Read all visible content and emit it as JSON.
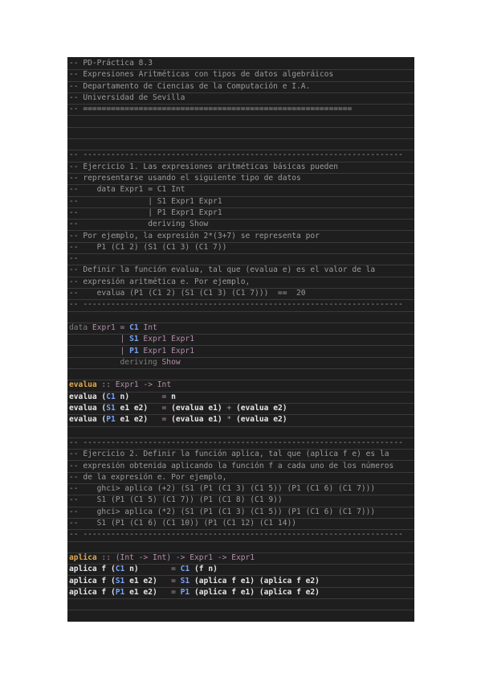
{
  "colors": {
    "background": "#ffffff",
    "editor_bg": "#1e1e1e",
    "comment": "#9b9b9b",
    "keyword": "#a78bc4",
    "type": "#b48ead",
    "constructor": "#7aa2f7",
    "function_name": "#e0a84c",
    "plain": "#e6e6e6"
  },
  "lines": [
    [
      {
        "t": "-- PD-Práctica 8.3",
        "c": "comment"
      }
    ],
    [
      {
        "t": "-- Expresiones Aritméticas con tipos de datos algebráicos",
        "c": "comment"
      }
    ],
    [
      {
        "t": "-- Departamento de Ciencias de la Computación e I.A.",
        "c": "comment"
      }
    ],
    [
      {
        "t": "-- Universidad de Sevilla",
        "c": "comment"
      }
    ],
    [
      {
        "t": "-- ==========================================================",
        "c": "comment"
      }
    ],
    [],
    [],
    [],
    [
      {
        "t": "-- ---------------------------------------------------------------------",
        "c": "comment"
      }
    ],
    [
      {
        "t": "-- Ejercicio 1. Las expresiones aritméticas básicas pueden",
        "c": "comment"
      }
    ],
    [
      {
        "t": "-- representarse usando el siguiente tipo de datos",
        "c": "comment"
      }
    ],
    [
      {
        "t": "--    data Expr1 = C1 Int",
        "c": "comment"
      }
    ],
    [
      {
        "t": "--               | S1 Expr1 Expr1",
        "c": "comment"
      }
    ],
    [
      {
        "t": "--               | P1 Expr1 Expr1",
        "c": "comment"
      }
    ],
    [
      {
        "t": "--               deriving Show",
        "c": "comment"
      }
    ],
    [
      {
        "t": "-- Por ejemplo, la expresión 2*(3+7) se representa por",
        "c": "comment"
      }
    ],
    [
      {
        "t": "--    P1 (C1 2) (S1 (C1 3) (C1 7))",
        "c": "comment"
      }
    ],
    [
      {
        "t": "--",
        "c": "comment"
      }
    ],
    [
      {
        "t": "-- Definir la función evalua, tal que (evalua e) es el valor de la",
        "c": "comment"
      }
    ],
    [
      {
        "t": "-- expresión aritmética e. Por ejemplo,",
        "c": "comment"
      }
    ],
    [
      {
        "t": "--    evalua (P1 (C1 2) (S1 (C1 3) (C1 7)))  ==  20",
        "c": "comment"
      }
    ],
    [
      {
        "t": "-- ---------------------------------------------------------------------",
        "c": "comment"
      }
    ],
    [],
    [
      {
        "t": "data ",
        "c": "faint"
      },
      {
        "t": "Expr1",
        "c": "type"
      },
      {
        "t": " = ",
        "c": "op"
      },
      {
        "t": "C1",
        "c": "ctor"
      },
      {
        "t": " Int",
        "c": "type"
      }
    ],
    [
      {
        "t": "           | ",
        "c": "op"
      },
      {
        "t": "S1",
        "c": "ctor"
      },
      {
        "t": " Expr1 Expr1",
        "c": "type"
      }
    ],
    [
      {
        "t": "           | ",
        "c": "op"
      },
      {
        "t": "P1",
        "c": "ctor"
      },
      {
        "t": " Expr1 Expr1",
        "c": "type"
      }
    ],
    [
      {
        "t": "           deriving ",
        "c": "faint"
      },
      {
        "t": "Show",
        "c": "type"
      }
    ],
    [],
    [
      {
        "t": "evalua",
        "c": "fname"
      },
      {
        "t": " :: ",
        "c": "op"
      },
      {
        "t": "Expr1",
        "c": "type"
      },
      {
        "t": " -> ",
        "c": "op"
      },
      {
        "t": "Int",
        "c": "type"
      }
    ],
    [
      {
        "t": "evalua (",
        "c": "plain"
      },
      {
        "t": "C1",
        "c": "ctor"
      },
      {
        "t": " n)       ",
        "c": "plain"
      },
      {
        "t": "= ",
        "c": "op"
      },
      {
        "t": "n",
        "c": "plain"
      }
    ],
    [
      {
        "t": "evalua (",
        "c": "plain"
      },
      {
        "t": "S1",
        "c": "ctor"
      },
      {
        "t": " e1 e2)   ",
        "c": "plain"
      },
      {
        "t": "= ",
        "c": "op"
      },
      {
        "t": "(evalua e1) ",
        "c": "plain"
      },
      {
        "t": "+ ",
        "c": "op"
      },
      {
        "t": "(evalua e2)",
        "c": "plain"
      }
    ],
    [
      {
        "t": "evalua (",
        "c": "plain"
      },
      {
        "t": "P1",
        "c": "ctor"
      },
      {
        "t": " e1 e2)   ",
        "c": "plain"
      },
      {
        "t": "= ",
        "c": "op"
      },
      {
        "t": "(evalua e1) ",
        "c": "plain"
      },
      {
        "t": "* ",
        "c": "op"
      },
      {
        "t": "(evalua e2)",
        "c": "plain"
      }
    ],
    [],
    [
      {
        "t": "-- ---------------------------------------------------------------------",
        "c": "comment"
      }
    ],
    [
      {
        "t": "-- Ejercicio 2. Definir la función aplica, tal que (aplica f e) es la",
        "c": "comment"
      }
    ],
    [
      {
        "t": "-- expresión obtenida aplicando la función f a cada uno de los números",
        "c": "comment"
      }
    ],
    [
      {
        "t": "-- de la expresión e. Por ejemplo,",
        "c": "comment"
      }
    ],
    [
      {
        "t": "--    ghci> aplica (+2) (S1 (P1 (C1 3) (C1 5)) (P1 (C1 6) (C1 7)))",
        "c": "comment"
      }
    ],
    [
      {
        "t": "--    S1 (P1 (C1 5) (C1 7)) (P1 (C1 8) (C1 9))",
        "c": "comment"
      }
    ],
    [
      {
        "t": "--    ghci> aplica (*2) (S1 (P1 (C1 3) (C1 5)) (P1 (C1 6) (C1 7)))",
        "c": "comment"
      }
    ],
    [
      {
        "t": "--    S1 (P1 (C1 6) (C1 10)) (P1 (C1 12) (C1 14))",
        "c": "comment"
      }
    ],
    [
      {
        "t": "-- ---------------------------------------------------------------------",
        "c": "comment"
      }
    ],
    [],
    [
      {
        "t": "aplica",
        "c": "fname"
      },
      {
        "t": " :: (",
        "c": "op"
      },
      {
        "t": "Int",
        "c": "type"
      },
      {
        "t": " -> ",
        "c": "op"
      },
      {
        "t": "Int",
        "c": "type"
      },
      {
        "t": ") -> ",
        "c": "op"
      },
      {
        "t": "Expr1",
        "c": "type"
      },
      {
        "t": " -> ",
        "c": "op"
      },
      {
        "t": "Expr1",
        "c": "type"
      }
    ],
    [
      {
        "t": "aplica f (",
        "c": "plain"
      },
      {
        "t": "C1",
        "c": "ctor"
      },
      {
        "t": " n)       ",
        "c": "plain"
      },
      {
        "t": "= ",
        "c": "op"
      },
      {
        "t": "C1",
        "c": "ctor"
      },
      {
        "t": " (f n)",
        "c": "plain"
      }
    ],
    [
      {
        "t": "aplica f (",
        "c": "plain"
      },
      {
        "t": "S1",
        "c": "ctor"
      },
      {
        "t": " e1 e2)   ",
        "c": "plain"
      },
      {
        "t": "= ",
        "c": "op"
      },
      {
        "t": "S1",
        "c": "ctor"
      },
      {
        "t": " (aplica f e1) (aplica f e2)",
        "c": "plain"
      }
    ],
    [
      {
        "t": "aplica f (",
        "c": "plain"
      },
      {
        "t": "P1",
        "c": "ctor"
      },
      {
        "t": " e1 e2)   ",
        "c": "plain"
      },
      {
        "t": "= ",
        "c": "op"
      },
      {
        "t": "P1",
        "c": "ctor"
      },
      {
        "t": " (aplica f e1) (aplica f e2)",
        "c": "plain"
      }
    ],
    [],
    [],
    [
      {
        "t": "-- ---------------------------------------------------------------------",
        "c": "comment"
      }
    ]
  ]
}
